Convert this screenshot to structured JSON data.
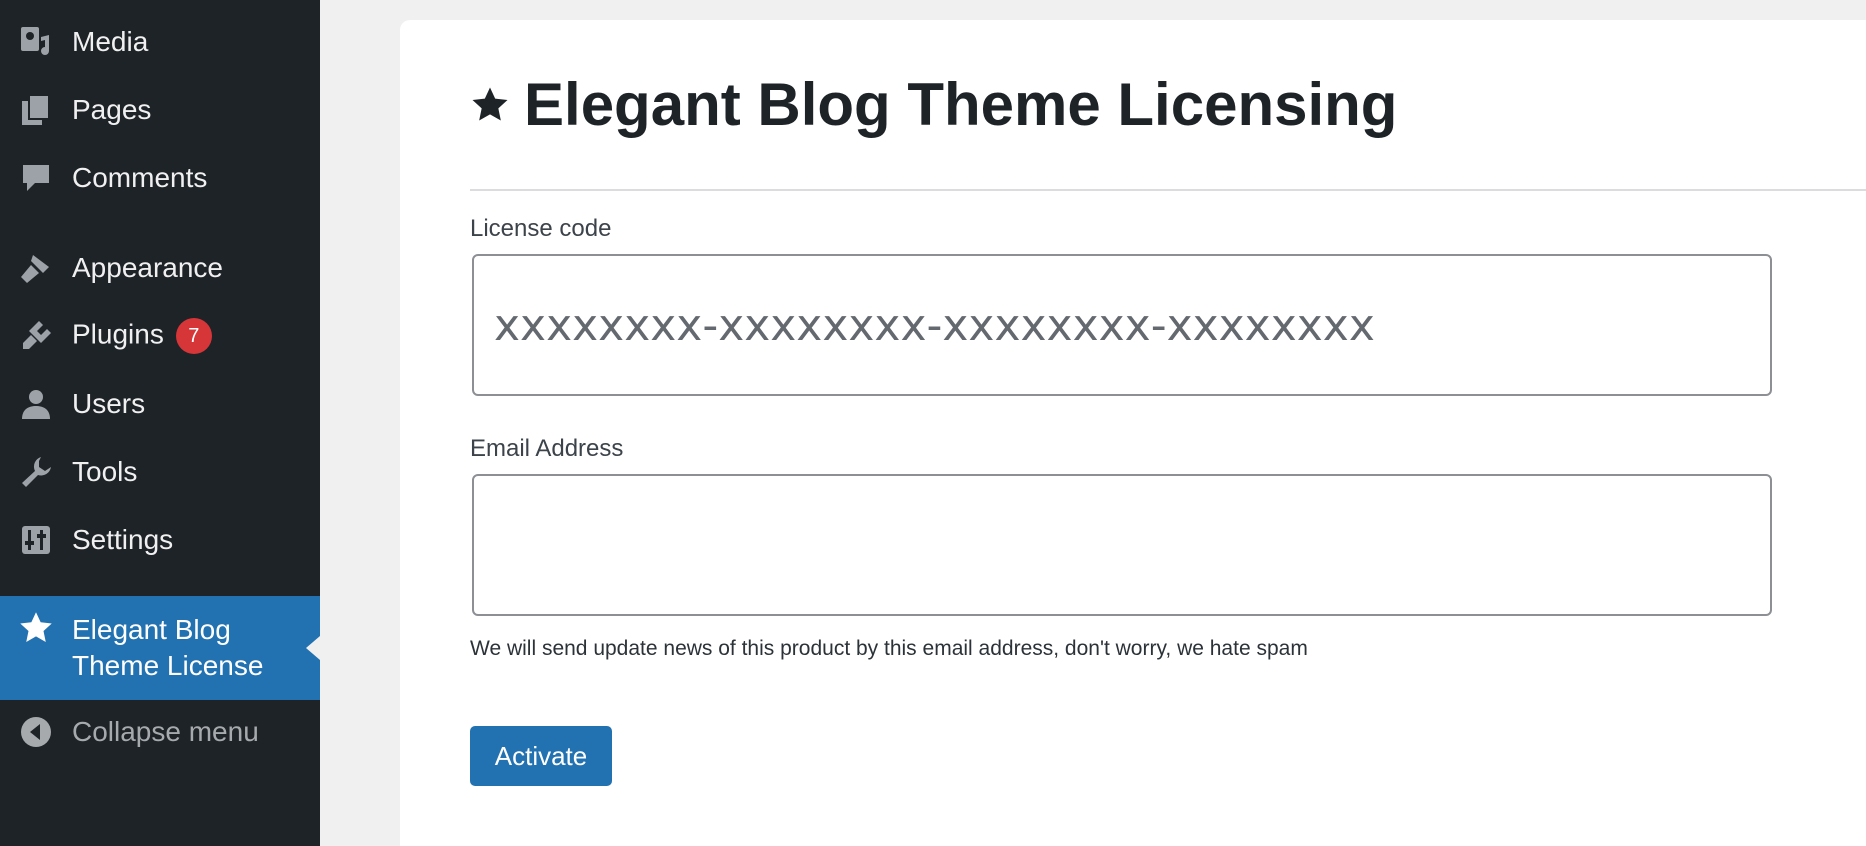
{
  "sidebar": {
    "items": [
      {
        "label": "Media",
        "icon": "media-icon"
      },
      {
        "label": "Pages",
        "icon": "pages-icon"
      },
      {
        "label": "Comments",
        "icon": "comments-icon"
      },
      {
        "label": "Appearance",
        "icon": "appearance-brush-icon"
      },
      {
        "label": "Plugins",
        "icon": "plugins-icon",
        "badge": "7"
      },
      {
        "label": "Users",
        "icon": "users-icon"
      },
      {
        "label": "Tools",
        "icon": "wrench-icon"
      },
      {
        "label": "Settings",
        "icon": "settings-sliders-icon"
      }
    ],
    "active_item": {
      "label_line1": "Elegant Blog",
      "label_line2": "Theme License",
      "icon": "star-icon"
    },
    "collapse": {
      "label": "Collapse menu",
      "icon": "collapse-arrow-icon"
    }
  },
  "page": {
    "title": "Elegant Blog Theme Licensing",
    "title_icon": "star-icon"
  },
  "form": {
    "license_label": "License code",
    "license_placeholder": "xxxxxxxx-xxxxxxxx-xxxxxxxx-xxxxxxxx",
    "license_value": "",
    "email_label": "Email Address",
    "email_placeholder": "",
    "email_value": "",
    "email_hint": "We will send update news of this product by this email address, don't worry, we hate spam",
    "submit_label": "Activate"
  },
  "colors": {
    "sidebar_bg": "#1d2327",
    "accent": "#2271b1",
    "badge": "#d63638",
    "page_bg": "#f0f0f1"
  }
}
